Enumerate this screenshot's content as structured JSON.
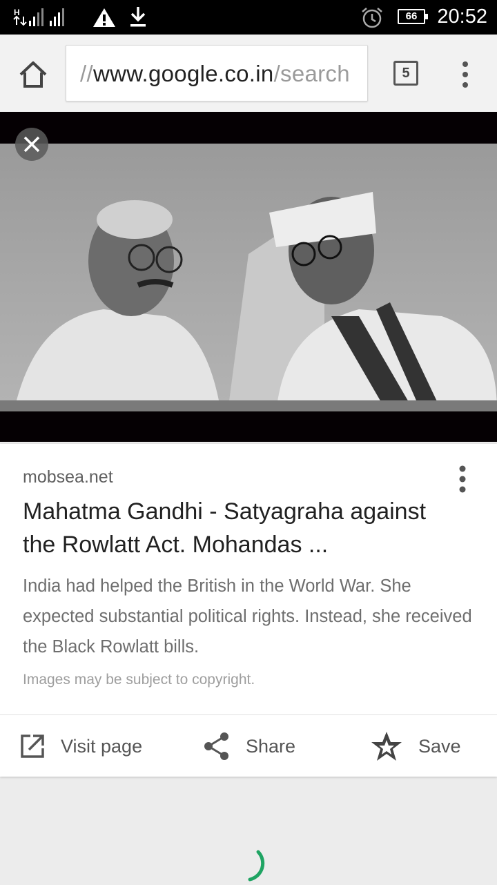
{
  "status_bar": {
    "time": "20:52",
    "battery": "66",
    "network_label": "H"
  },
  "browser": {
    "url_prefix": "//",
    "url_main": "www.google.co.in",
    "url_suffix": "/search",
    "tab_count": "5"
  },
  "result": {
    "source": "mobsea.net",
    "title": "Mahatma Gandhi - Satyagraha against the Rowlatt Act. Mohandas ...",
    "snippet": "India had helped the British in the World War. She expected substantial political rights. Instead, she received the Black Rowlatt bills.",
    "copyright": "Images may be subject to copyright."
  },
  "actions": {
    "visit": "Visit page",
    "share": "Share",
    "save": "Save"
  },
  "colors": {
    "spinner": "#1fa463",
    "status_bar_bg": "#000000",
    "toolbar_bg": "#f2f2f2"
  }
}
